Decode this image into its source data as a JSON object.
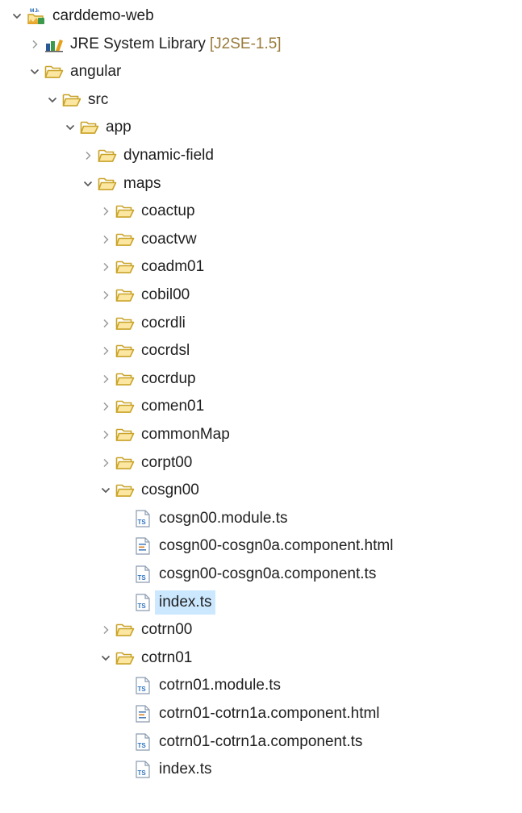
{
  "project_explorer": {
    "items": [
      {
        "label": "carddemo-web",
        "icon": "web-project-icon",
        "expanded": true,
        "depth": 0,
        "node_type": "project"
      },
      {
        "label": "JRE System Library",
        "decoration": "[J2SE-1.5]",
        "icon": "library-icon",
        "expanded": false,
        "depth": 1,
        "node_type": "library"
      },
      {
        "label": "angular",
        "icon": "folder-icon",
        "expanded": true,
        "depth": 1,
        "node_type": "folder"
      },
      {
        "label": "src",
        "icon": "folder-icon",
        "expanded": true,
        "depth": 2,
        "node_type": "folder"
      },
      {
        "label": "app",
        "icon": "folder-icon",
        "expanded": true,
        "depth": 3,
        "node_type": "folder"
      },
      {
        "label": "dynamic-field",
        "icon": "folder-icon",
        "expanded": false,
        "depth": 4,
        "node_type": "folder"
      },
      {
        "label": "maps",
        "icon": "folder-icon",
        "expanded": true,
        "depth": 4,
        "node_type": "folder"
      },
      {
        "label": "coactup",
        "icon": "folder-icon",
        "expanded": false,
        "depth": 5,
        "node_type": "folder"
      },
      {
        "label": "coactvw",
        "icon": "folder-icon",
        "expanded": false,
        "depth": 5,
        "node_type": "folder"
      },
      {
        "label": "coadm01",
        "icon": "folder-icon",
        "expanded": false,
        "depth": 5,
        "node_type": "folder"
      },
      {
        "label": "cobil00",
        "icon": "folder-icon",
        "expanded": false,
        "depth": 5,
        "node_type": "folder"
      },
      {
        "label": "cocrdli",
        "icon": "folder-icon",
        "expanded": false,
        "depth": 5,
        "node_type": "folder"
      },
      {
        "label": "cocrdsl",
        "icon": "folder-icon",
        "expanded": false,
        "depth": 5,
        "node_type": "folder"
      },
      {
        "label": "cocrdup",
        "icon": "folder-icon",
        "expanded": false,
        "depth": 5,
        "node_type": "folder"
      },
      {
        "label": "comen01",
        "icon": "folder-icon",
        "expanded": false,
        "depth": 5,
        "node_type": "folder"
      },
      {
        "label": "commonMap",
        "icon": "folder-icon",
        "expanded": false,
        "depth": 5,
        "node_type": "folder"
      },
      {
        "label": "corpt00",
        "icon": "folder-icon",
        "expanded": false,
        "depth": 5,
        "node_type": "folder"
      },
      {
        "label": "cosgn00",
        "icon": "folder-icon",
        "expanded": true,
        "depth": 5,
        "node_type": "folder"
      },
      {
        "label": "cosgn00.module.ts",
        "icon": "typescript-file-icon",
        "depth": 6,
        "node_type": "file"
      },
      {
        "label": "cosgn00-cosgn0a.component.html",
        "icon": "html-file-icon",
        "depth": 6,
        "node_type": "file"
      },
      {
        "label": "cosgn00-cosgn0a.component.ts",
        "icon": "typescript-file-icon",
        "depth": 6,
        "node_type": "file"
      },
      {
        "label": "index.ts",
        "icon": "typescript-file-icon",
        "depth": 6,
        "node_type": "file",
        "selected": true
      },
      {
        "label": "cotrn00",
        "icon": "folder-icon",
        "expanded": false,
        "depth": 5,
        "node_type": "folder"
      },
      {
        "label": "cotrn01",
        "icon": "folder-icon",
        "expanded": true,
        "depth": 5,
        "node_type": "folder"
      },
      {
        "label": "cotrn01.module.ts",
        "icon": "typescript-file-icon",
        "depth": 6,
        "node_type": "file"
      },
      {
        "label": "cotrn01-cotrn1a.component.html",
        "icon": "html-file-icon",
        "depth": 6,
        "node_type": "file"
      },
      {
        "label": "cotrn01-cotrn1a.component.ts",
        "icon": "typescript-file-icon",
        "depth": 6,
        "node_type": "file"
      },
      {
        "label": "index.ts",
        "icon": "typescript-file-icon",
        "depth": 6,
        "node_type": "file"
      }
    ]
  },
  "colors": {
    "folder_outline": "#c9a227",
    "folder_fill": "#fbe7a1",
    "library_blue": "#2b5797",
    "library_green": "#3c9a4c",
    "ts_blue": "#2f74c0",
    "html_blue": "#4a7ebb",
    "selection": "#cce8ff",
    "decoration_text": "#9a7b3b",
    "chevron": "#5a5a5a"
  }
}
